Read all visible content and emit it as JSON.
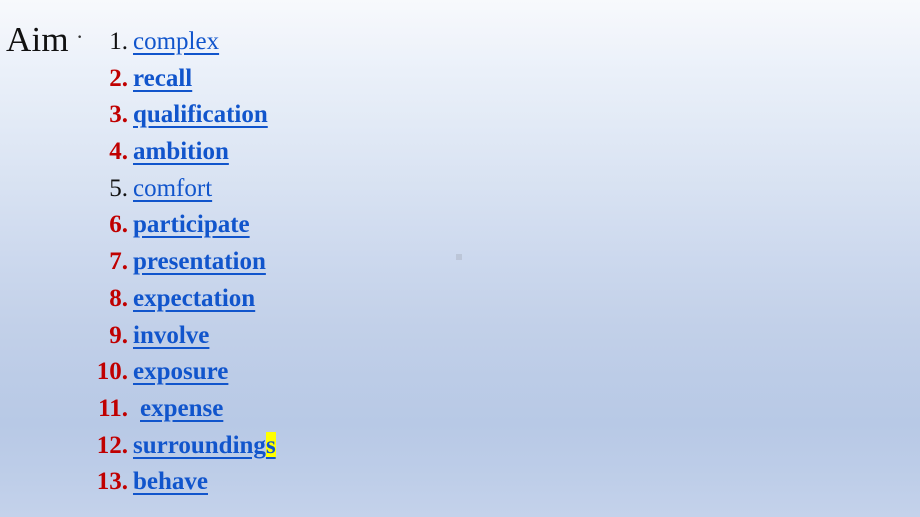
{
  "slide": {
    "title": "Aim",
    "background_top_color": "#f7f9fc",
    "background_bottom_color": "#c4d2eb",
    "number_color_emphasis": "#C00000",
    "number_color_plain": "#111111",
    "word_color": "#1155CC",
    "highlight_color": "#FFFF00",
    "stray_mark": "·"
  },
  "list": {
    "items": [
      {
        "number": "1.",
        "word": "complex",
        "style": "plain"
      },
      {
        "number": "2.",
        "word": "recall",
        "style": "bold"
      },
      {
        "number": "3.",
        "word": "qualification",
        "style": "bold"
      },
      {
        "number": "4.",
        "word": "ambition",
        "style": "bold"
      },
      {
        "number": "5.",
        "word": "comfort",
        "style": "plain"
      },
      {
        "number": "6.",
        "word": "participate",
        "style": "bold"
      },
      {
        "number": "7.",
        "word": "presentation",
        "style": "bold"
      },
      {
        "number": "8.",
        "word": "expectation",
        "style": "bold"
      },
      {
        "number": "9.",
        "word": "involve",
        "style": "bold"
      },
      {
        "number": "10.",
        "word": "exposure",
        "style": "bold"
      },
      {
        "number": "11.",
        "word": "expense",
        "style": "bold",
        "indent": true
      },
      {
        "number": "12.",
        "word": "surroundings",
        "style": "bold",
        "highlight_tail": "s",
        "word_head": "surrounding"
      },
      {
        "number": "13.",
        "word": "behave",
        "style": "bold"
      }
    ]
  }
}
